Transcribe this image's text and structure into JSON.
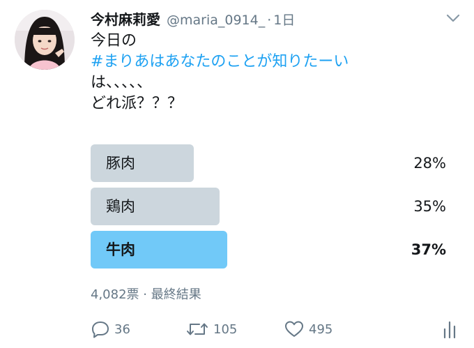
{
  "tweet": {
    "display_name": "今村麻莉愛",
    "handle": "@maria_0914_",
    "separator": "·",
    "time": "1日",
    "text_line1": "今日の",
    "hashtag": "#まりあはあなたのことが知りたーい",
    "text_line3": "は、、、、、",
    "text_line4": "どれ派？？？"
  },
  "poll": {
    "options": [
      {
        "label": "豚肉",
        "percent_label": "28%",
        "percent": 28
      },
      {
        "label": "鶏肉",
        "percent_label": "35%",
        "percent": 35
      },
      {
        "label": "牛肉",
        "percent_label": "37%",
        "percent": 37
      }
    ],
    "votes": "4,082票",
    "meta_separator": "·",
    "status": "最終結果",
    "winner_color": "#71c9f8",
    "bar_color": "#ccd6dd"
  },
  "actions": {
    "reply_count": "36",
    "retweet_count": "105",
    "like_count": "495",
    "icons": [
      "reply-icon",
      "retweet-icon",
      "like-icon",
      "analytics-icon"
    ]
  },
  "colors": {
    "link": "#1da1f2",
    "muted": "#657786",
    "text": "#14171a"
  }
}
